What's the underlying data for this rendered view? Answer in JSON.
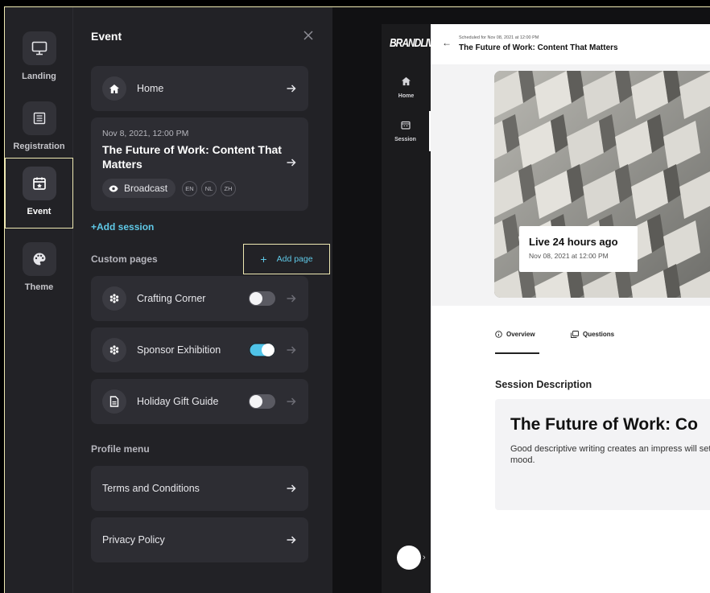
{
  "sidebar": {
    "items": [
      {
        "label": "Landing",
        "icon": "monitor-icon"
      },
      {
        "label": "Registration",
        "icon": "form-icon"
      },
      {
        "label": "Event",
        "icon": "calendar-star-icon",
        "active": true
      },
      {
        "label": "Theme",
        "icon": "palette-icon"
      }
    ]
  },
  "panel": {
    "title": "Event",
    "home_label": "Home",
    "session": {
      "date": "Nov 8, 2021, 12:00 PM",
      "title": "The Future of Work: Content That Matters",
      "broadcast_label": "Broadcast",
      "languages": [
        "EN",
        "NL",
        "ZH"
      ]
    },
    "add_session": "+Add session",
    "custom_pages_heading": "Custom pages",
    "add_page_label": "Add page",
    "pages": [
      {
        "label": "Crafting Corner",
        "enabled": false,
        "icon": "flower-icon"
      },
      {
        "label": "Sponsor Exhibition",
        "enabled": true,
        "icon": "flower-icon"
      },
      {
        "label": "Holiday Gift Guide",
        "enabled": false,
        "icon": "document-icon"
      }
    ],
    "profile_menu_heading": "Profile menu",
    "profile_items": [
      "Terms and Conditions",
      "Privacy Policy"
    ]
  },
  "preview": {
    "brand": "BRANDLIVE",
    "nav": [
      {
        "label": "Home",
        "icon": "home-icon"
      },
      {
        "label": "Session",
        "icon": "session-icon",
        "active": true
      }
    ],
    "scheduled": "Scheduled for Nov 08, 2021 at 12:00 PM",
    "title": "The Future of Work: Content That Matters",
    "live_title": "Live 24 hours ago",
    "live_date": "Nov 08, 2021 at 12:00 PM",
    "tabs": [
      {
        "label": "Overview",
        "icon": "info-icon"
      },
      {
        "label": "Questions",
        "icon": "questions-icon"
      }
    ],
    "description_heading": "Session Description",
    "description_title": "The Future of Work: Co",
    "description_body": "Good descriptive writing creates an impress will set a mood."
  },
  "colors": {
    "accent": "#5fc8e6",
    "highlight_border": "#efe9b3",
    "panel_bg": "#222226",
    "card_bg": "#2d2d33"
  }
}
